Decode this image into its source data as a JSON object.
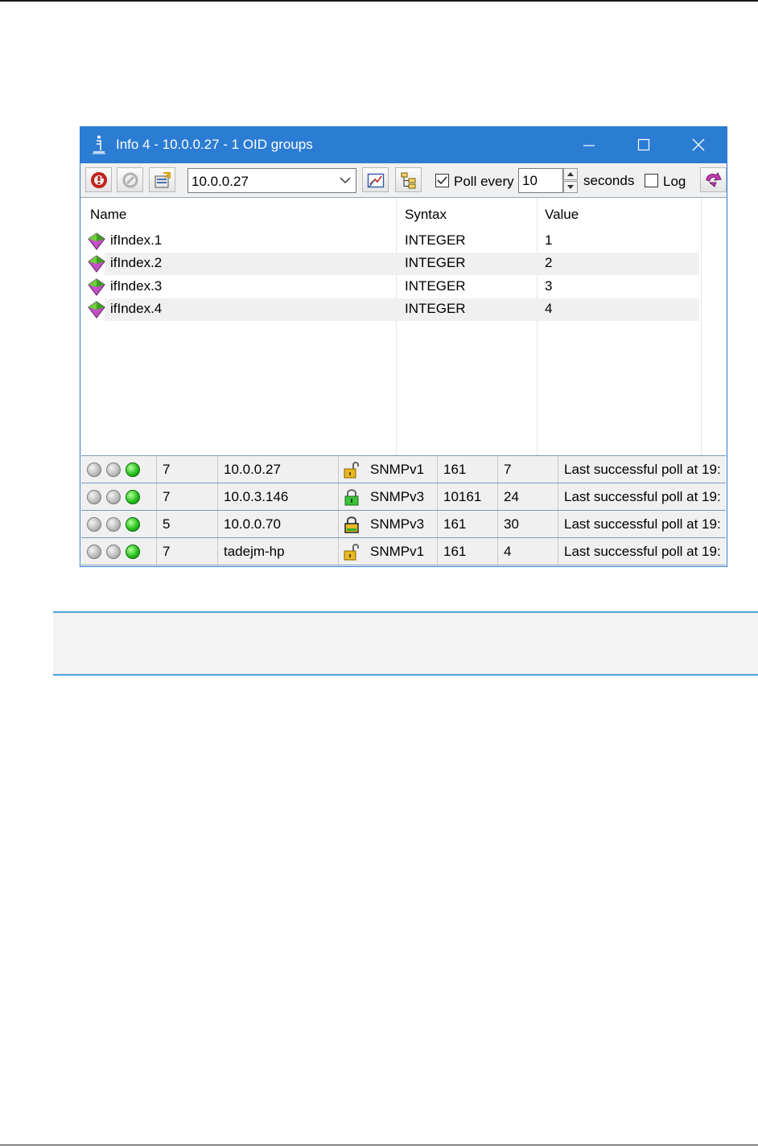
{
  "window": {
    "title": "Info 4  -  10.0.0.27  -  1 OID groups"
  },
  "toolbar": {
    "agent_address": "10.0.0.27",
    "poll_every_label": "Poll every",
    "poll_every_checked": true,
    "poll_interval": "10",
    "seconds_label": "seconds",
    "log_label": "Log",
    "log_checked": false
  },
  "oid_table": {
    "columns": [
      "Name",
      "Syntax",
      "Value"
    ],
    "rows": [
      {
        "name": "ifIndex.1",
        "syntax": "INTEGER",
        "value": "1"
      },
      {
        "name": "ifIndex.2",
        "syntax": "INTEGER",
        "value": "2"
      },
      {
        "name": "ifIndex.3",
        "syntax": "INTEGER",
        "value": "3"
      },
      {
        "name": "ifIndex.4",
        "syntax": "INTEGER",
        "value": "4"
      }
    ]
  },
  "agents": [
    {
      "count": "7",
      "host": "10.0.0.27",
      "version": "SNMPv1",
      "port": "161",
      "responses": "7",
      "status": "Last successful poll at 19:",
      "lock": "open-yellow"
    },
    {
      "count": "7",
      "host": "10.0.3.146",
      "version": "SNMPv3",
      "port": "10161",
      "responses": "24",
      "status": "Last successful poll at 19:",
      "lock": "closed-green"
    },
    {
      "count": "5",
      "host": "10.0.0.70",
      "version": "SNMPv3",
      "port": "161",
      "responses": "30",
      "status": "Last successful poll at 19:",
      "lock": "closed-yellow"
    },
    {
      "count": "7",
      "host": "tadejm-hp",
      "version": "SNMPv1",
      "port": "161",
      "responses": "4",
      "status": "Last successful poll at 19:",
      "lock": "open-yellow"
    }
  ],
  "colors": {
    "titlebar": "#2b7cd3",
    "led_on": "#27c21e",
    "note_border": "#4da3d6"
  }
}
